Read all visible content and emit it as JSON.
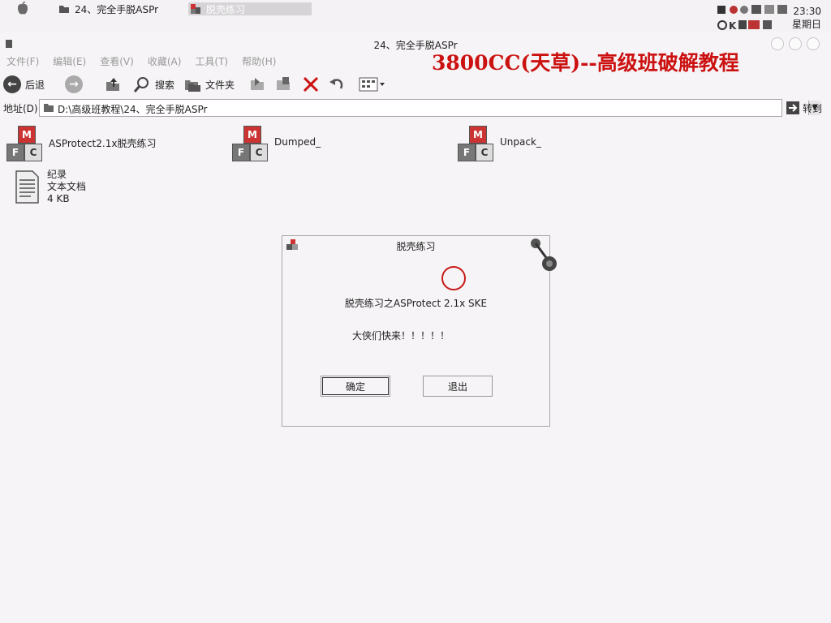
{
  "taskbar": {
    "tasks": [
      {
        "label": "24、完全手脱ASPr"
      },
      {
        "label": "脱壳练习"
      }
    ],
    "clock": {
      "time": "23:30",
      "day": "星期日"
    }
  },
  "window": {
    "title": "24、完全手脱ASPr",
    "menu": [
      "文件(F)",
      "编辑(E)",
      "查看(V)",
      "收藏(A)",
      "工具(T)",
      "帮助(H)"
    ],
    "banner": "3800CC(天草)--高级班破解教程",
    "toolbar": {
      "back": "后退",
      "search": "搜索",
      "folders": "文件夹"
    },
    "address": {
      "label": "地址(D)",
      "path": "D:\\高级班教程\\24、完全手脱ASPr",
      "go": "转到"
    }
  },
  "files": [
    {
      "name": "ASProtect2.1x脱壳练习",
      "icon": "mfc-app-icon"
    },
    {
      "name": "Dumped_",
      "icon": "mfc-app-icon"
    },
    {
      "name": "Unpack_",
      "icon": "mfc-app-icon"
    },
    {
      "name": "纪录",
      "type": "文本文档",
      "size": "4 KB",
      "icon": "text-document-icon"
    }
  ],
  "dialog": {
    "title": "脱壳练习",
    "message": "脱壳练习之ASProtect 2.1x SKE",
    "prompt": "大侠们快来！！！！！",
    "ok_label": "确定",
    "cancel_label": "退出"
  },
  "colors": {
    "banner": "#cc1111",
    "background": "#f6f4f6",
    "marker": "#c81818"
  }
}
